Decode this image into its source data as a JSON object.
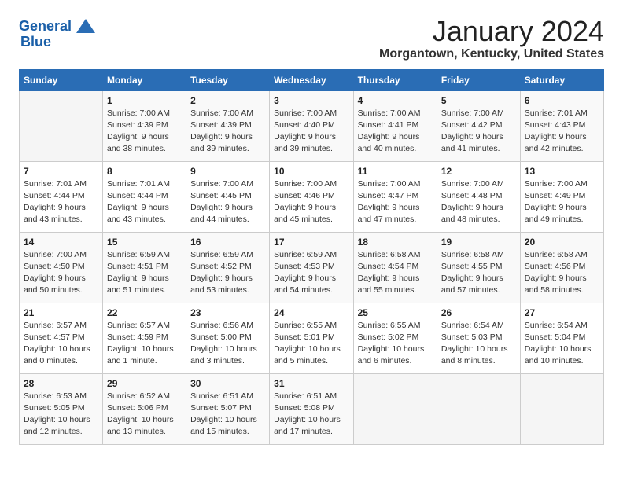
{
  "header": {
    "logo_line1": "General",
    "logo_line2": "Blue",
    "month": "January 2024",
    "location": "Morgantown, Kentucky, United States"
  },
  "days_of_week": [
    "Sunday",
    "Monday",
    "Tuesday",
    "Wednesday",
    "Thursday",
    "Friday",
    "Saturday"
  ],
  "weeks": [
    [
      {
        "day": "",
        "info": ""
      },
      {
        "day": "1",
        "info": "Sunrise: 7:00 AM\nSunset: 4:39 PM\nDaylight: 9 hours\nand 38 minutes."
      },
      {
        "day": "2",
        "info": "Sunrise: 7:00 AM\nSunset: 4:39 PM\nDaylight: 9 hours\nand 39 minutes."
      },
      {
        "day": "3",
        "info": "Sunrise: 7:00 AM\nSunset: 4:40 PM\nDaylight: 9 hours\nand 39 minutes."
      },
      {
        "day": "4",
        "info": "Sunrise: 7:00 AM\nSunset: 4:41 PM\nDaylight: 9 hours\nand 40 minutes."
      },
      {
        "day": "5",
        "info": "Sunrise: 7:00 AM\nSunset: 4:42 PM\nDaylight: 9 hours\nand 41 minutes."
      },
      {
        "day": "6",
        "info": "Sunrise: 7:01 AM\nSunset: 4:43 PM\nDaylight: 9 hours\nand 42 minutes."
      }
    ],
    [
      {
        "day": "7",
        "info": "Sunrise: 7:01 AM\nSunset: 4:44 PM\nDaylight: 9 hours\nand 43 minutes."
      },
      {
        "day": "8",
        "info": "Sunrise: 7:01 AM\nSunset: 4:44 PM\nDaylight: 9 hours\nand 43 minutes."
      },
      {
        "day": "9",
        "info": "Sunrise: 7:00 AM\nSunset: 4:45 PM\nDaylight: 9 hours\nand 44 minutes."
      },
      {
        "day": "10",
        "info": "Sunrise: 7:00 AM\nSunset: 4:46 PM\nDaylight: 9 hours\nand 45 minutes."
      },
      {
        "day": "11",
        "info": "Sunrise: 7:00 AM\nSunset: 4:47 PM\nDaylight: 9 hours\nand 47 minutes."
      },
      {
        "day": "12",
        "info": "Sunrise: 7:00 AM\nSunset: 4:48 PM\nDaylight: 9 hours\nand 48 minutes."
      },
      {
        "day": "13",
        "info": "Sunrise: 7:00 AM\nSunset: 4:49 PM\nDaylight: 9 hours\nand 49 minutes."
      }
    ],
    [
      {
        "day": "14",
        "info": "Sunrise: 7:00 AM\nSunset: 4:50 PM\nDaylight: 9 hours\nand 50 minutes."
      },
      {
        "day": "15",
        "info": "Sunrise: 6:59 AM\nSunset: 4:51 PM\nDaylight: 9 hours\nand 51 minutes."
      },
      {
        "day": "16",
        "info": "Sunrise: 6:59 AM\nSunset: 4:52 PM\nDaylight: 9 hours\nand 53 minutes."
      },
      {
        "day": "17",
        "info": "Sunrise: 6:59 AM\nSunset: 4:53 PM\nDaylight: 9 hours\nand 54 minutes."
      },
      {
        "day": "18",
        "info": "Sunrise: 6:58 AM\nSunset: 4:54 PM\nDaylight: 9 hours\nand 55 minutes."
      },
      {
        "day": "19",
        "info": "Sunrise: 6:58 AM\nSunset: 4:55 PM\nDaylight: 9 hours\nand 57 minutes."
      },
      {
        "day": "20",
        "info": "Sunrise: 6:58 AM\nSunset: 4:56 PM\nDaylight: 9 hours\nand 58 minutes."
      }
    ],
    [
      {
        "day": "21",
        "info": "Sunrise: 6:57 AM\nSunset: 4:57 PM\nDaylight: 10 hours\nand 0 minutes."
      },
      {
        "day": "22",
        "info": "Sunrise: 6:57 AM\nSunset: 4:59 PM\nDaylight: 10 hours\nand 1 minute."
      },
      {
        "day": "23",
        "info": "Sunrise: 6:56 AM\nSunset: 5:00 PM\nDaylight: 10 hours\nand 3 minutes."
      },
      {
        "day": "24",
        "info": "Sunrise: 6:55 AM\nSunset: 5:01 PM\nDaylight: 10 hours\nand 5 minutes."
      },
      {
        "day": "25",
        "info": "Sunrise: 6:55 AM\nSunset: 5:02 PM\nDaylight: 10 hours\nand 6 minutes."
      },
      {
        "day": "26",
        "info": "Sunrise: 6:54 AM\nSunset: 5:03 PM\nDaylight: 10 hours\nand 8 minutes."
      },
      {
        "day": "27",
        "info": "Sunrise: 6:54 AM\nSunset: 5:04 PM\nDaylight: 10 hours\nand 10 minutes."
      }
    ],
    [
      {
        "day": "28",
        "info": "Sunrise: 6:53 AM\nSunset: 5:05 PM\nDaylight: 10 hours\nand 12 minutes."
      },
      {
        "day": "29",
        "info": "Sunrise: 6:52 AM\nSunset: 5:06 PM\nDaylight: 10 hours\nand 13 minutes."
      },
      {
        "day": "30",
        "info": "Sunrise: 6:51 AM\nSunset: 5:07 PM\nDaylight: 10 hours\nand 15 minutes."
      },
      {
        "day": "31",
        "info": "Sunrise: 6:51 AM\nSunset: 5:08 PM\nDaylight: 10 hours\nand 17 minutes."
      },
      {
        "day": "",
        "info": ""
      },
      {
        "day": "",
        "info": ""
      },
      {
        "day": "",
        "info": ""
      }
    ]
  ]
}
